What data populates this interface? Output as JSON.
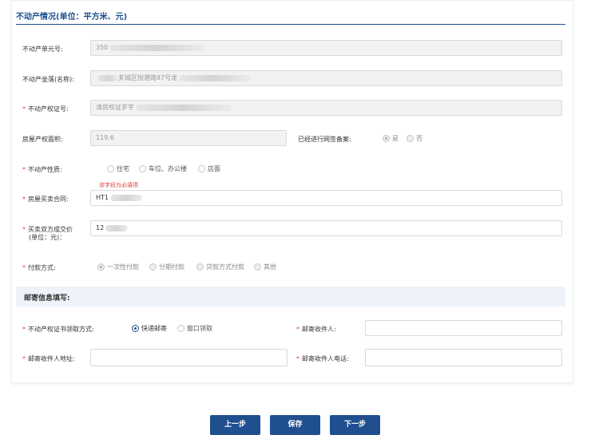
{
  "section": {
    "title": "不动产情况(单位：平方米、元)"
  },
  "fields": {
    "unit_no": {
      "label": "不动产单元号:",
      "value": "350"
    },
    "location": {
      "label": "不动产坐落(名称):",
      "value": "芗城区悦港路87号龙"
    },
    "cert_no": {
      "label": "不动产权证号:",
      "value": "漳房权证芗字"
    },
    "area": {
      "label": "房屋产权面积:",
      "value": "119.6"
    },
    "filed": {
      "label": "已经进行网签备案:",
      "options": [
        "是",
        "否"
      ]
    },
    "nature": {
      "label": "不动产性质:",
      "options": [
        "住宅",
        "车位、办公楼",
        "店面"
      ]
    },
    "required_error": "该字段为必填项",
    "contract": {
      "label": "房屋买卖合同:",
      "value": "HT1"
    },
    "price": {
      "label_line1": "买卖双方成交价",
      "label_line2": "(单位：元)：",
      "value": "12"
    },
    "payment": {
      "label": "付款方式:",
      "options": [
        "一次性付款",
        "分期付款",
        "贷款方式付款",
        "其他"
      ]
    }
  },
  "mail": {
    "title": "邮寄信息填写:",
    "pickup": {
      "label": "不动产权证书领取方式:",
      "options": [
        "快递邮寄",
        "窗口领取"
      ]
    },
    "recipient": {
      "label": "邮寄收件人:",
      "value": ""
    },
    "address": {
      "label": "邮寄收件人地址:",
      "value": ""
    },
    "phone": {
      "label": "邮寄收件人电话:",
      "value": ""
    }
  },
  "buttons": {
    "prev": "上一步",
    "save": "保存",
    "next": "下一步"
  },
  "colors": {
    "primary": "#1f4f8f",
    "required": "#e04040",
    "subhead_bg": "#eef3f9"
  }
}
